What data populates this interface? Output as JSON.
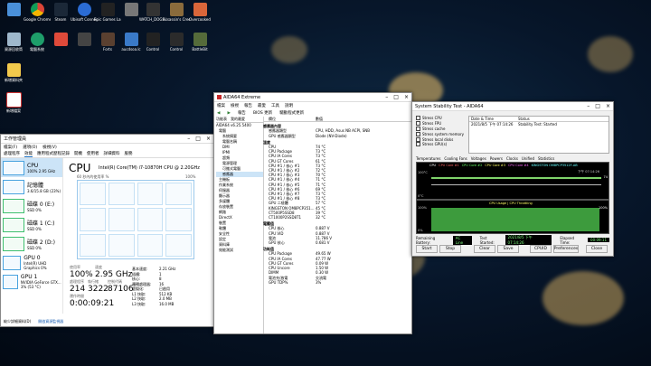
{
  "desktop": {
    "icons_row1": [
      "",
      "Google Chrome",
      "Steam",
      "Ubisoft Connect",
      "Epic Games Launcher",
      "",
      "WATCH_DOGS 2",
      "Assassin's Creed Origins",
      "Overcooked"
    ],
    "icons_row2": [
      "資源回收筒",
      "電腦系統",
      "",
      "",
      "Forts",
      "aucdsoa.lc",
      "Control",
      "Control",
      "BattleBit"
    ],
    "icons_row3": [
      "新增資料夾"
    ],
    "icons_row4": [
      "新增檔案"
    ]
  },
  "task_manager": {
    "title": "工作管理員",
    "menu": [
      "檔案(F)",
      "選項(O)",
      "檢視(V)"
    ],
    "tabs": [
      "處理程序",
      "效能",
      "應用程式歷程記錄",
      "開機",
      "使用者",
      "詳細資料",
      "服務"
    ],
    "side": [
      {
        "name": "CPU",
        "sub": "100% 2.95 GHz"
      },
      {
        "name": "記憶體",
        "sub": "3.6/15.8 GB (23%)"
      },
      {
        "name": "磁碟 0 (E:)",
        "sub": "SSD 0%"
      },
      {
        "name": "磁碟 1 (C:)",
        "sub": "SSD 0%"
      },
      {
        "name": "磁碟 2 (D:)",
        "sub": "SSD 0%"
      },
      {
        "name": "GPU 0",
        "sub": "Intel(R) UHD Graphics 0%"
      },
      {
        "name": "GPU 1",
        "sub": "NVIDIA GeForce GTX... 3% (53 °C)"
      }
    ],
    "heading": "CPU",
    "cpu_model": "Intel(R) Core(TM) i7-10870H CPU @ 2.20GHz",
    "graph_label": "60 秒內的使用率 %",
    "graph_max": "100%",
    "stats": {
      "util_label": "使用率",
      "util": "100%",
      "speed_label": "速度",
      "speed": "2.95 GHz",
      "proc_label": "處理程序",
      "proc": "214",
      "thread_label": "執行緒",
      "thread": "3222",
      "handle_label": "控制代碼",
      "handle": "87106",
      "uptime_label": "運作時間",
      "uptime": "0:00:09:21"
    },
    "specs": [
      [
        "基本速度:",
        "2.21 GHz"
      ],
      [
        "插槽:",
        "1"
      ],
      [
        "核心:",
        "8"
      ],
      [
        "邏輯處理器:",
        "16"
      ],
      [
        "虛擬化:",
        "已啟用"
      ],
      [
        "L1 快取:",
        "512 KB"
      ],
      [
        "L2 快取:",
        "2.0 MB"
      ],
      [
        "L3 快取:",
        "16.0 MB"
      ]
    ],
    "footer_less": "較少詳細資料(D)",
    "footer_monitor": "開啟資源監視器"
  },
  "aida": {
    "title": "AIDA64 Extreme",
    "menu": [
      "檔案",
      "檢視",
      "報告",
      "最愛",
      "工具",
      "說明"
    ],
    "toolbar": [
      "報告",
      "BIOS 更新",
      "驅動程式更新"
    ],
    "tabs": [
      "功能表",
      "我的最愛"
    ],
    "tree": [
      "AIDA64 v6.25.5400",
      "電腦",
      "系統摘要",
      "電腦名稱",
      "DMI",
      "IPMI",
      "超頻",
      "電源管理",
      "可攜式電腦",
      "感應器",
      "主機板",
      "作業系統",
      "伺服器",
      "顯示器",
      "多媒體",
      "存放裝置",
      "網路",
      "DirectX",
      "裝置",
      "軟體",
      "安全性",
      "設定",
      "資料庫",
      "效能測試"
    ],
    "col_field": "欄位",
    "col_value": "數值",
    "sections": [
      {
        "title": "感應器內容",
        "rows": [
          [
            "感應器類型",
            "CPU, HDD, Asus NB ACPI, SNB"
          ],
          [
            "GPU 感應器類型",
            "Diode (NV-Diode)"
          ]
        ]
      },
      {
        "title": "溫度",
        "rows": [
          [
            "CPU",
            "74 °C"
          ],
          [
            "CPU Package",
            "73 °C"
          ],
          [
            "CPU IA Cores",
            "73 °C"
          ],
          [
            "CPU GT Cores",
            "61 °C"
          ],
          [
            "CPU #1 / 核心 #1",
            "73 °C"
          ],
          [
            "CPU #1 / 核心 #2",
            "72 °C"
          ],
          [
            "CPU #1 / 核心 #3",
            "70 °C"
          ],
          [
            "CPU #1 / 核心 #4",
            "71 °C"
          ],
          [
            "CPU #1 / 核心 #5",
            "71 °C"
          ],
          [
            "CPU #1 / 核心 #6",
            "69 °C"
          ],
          [
            "CPU #1 / 核心 #7",
            "73 °C"
          ],
          [
            "CPU #1 / 核心 #8",
            "73 °C"
          ],
          [
            "GPU 二極體",
            "57 °C"
          ],
          [
            "KINGSTON OM8PCP351...",
            "45 °C"
          ],
          [
            "CT500P5SSD8",
            "39 °C"
          ],
          [
            "CT1000P2SSD8T1",
            "32 °C"
          ]
        ]
      },
      {
        "title": "電壓值",
        "rows": [
          [
            "CPU 核心",
            "0.887 V"
          ],
          [
            "CPU VID",
            "0.887 V"
          ],
          [
            "電池",
            "11.786 V"
          ],
          [
            "GPU 核心",
            "0.681 V"
          ]
        ]
      },
      {
        "title": "功耗值",
        "rows": [
          [
            "CPU Package",
            "49.65 W"
          ],
          [
            "CPU IA Cores",
            "47.77 W"
          ],
          [
            "CPU GT Cores",
            "0.09 W"
          ],
          [
            "CPU Uncore",
            "1.50 W"
          ],
          [
            "DIMM",
            "0.30 W"
          ],
          [
            "電池充/放電",
            "交流電"
          ],
          [
            "GPU TDP%",
            "3%"
          ]
        ]
      }
    ]
  },
  "stability": {
    "title": "System Stability Test - AIDA64",
    "checks": [
      "Stress CPU",
      "Stress FPU",
      "Stress cache",
      "Stress system memory",
      "Stress local disks",
      "Stress GPU(s)"
    ],
    "table_headers": [
      "Date & Time",
      "Status"
    ],
    "table_rows": [
      [
        "2021/8/5 下午 07:14:26",
        "Stability Test: Started"
      ]
    ],
    "graph_tabs": [
      "Temperatures",
      "Cooling Fans",
      "Voltages",
      "Powers",
      "Clocks",
      "Unified",
      "Statistics"
    ],
    "legend": [
      "CPU",
      "CPU Core #1",
      "CPU Core #2",
      "CPU Core #3",
      "CPU Core #4",
      "KINGSTON OM8PCP3512F-AB"
    ],
    "temp_top": "100°C",
    "temp_bottom": "0°C",
    "temp_readout": "74",
    "time_label": "下午 07:14:26",
    "usage_title": "CPU Usage | CPU Throttling",
    "usage_top": "100%",
    "usage_bottom": "0%",
    "usage_right": "100%",
    "battery_label": "Remaining Battery:",
    "battery_value": "AC Line",
    "started_label": "Test Started:",
    "started_value": "2021/8/5 下午 07:14:26",
    "elapsed_label": "Elapsed Time:",
    "elapsed_value": "00:09:11",
    "buttons": [
      "Start",
      "Stop",
      "Clear",
      "Save",
      "CPUID",
      "Preferences",
      "Close"
    ]
  }
}
